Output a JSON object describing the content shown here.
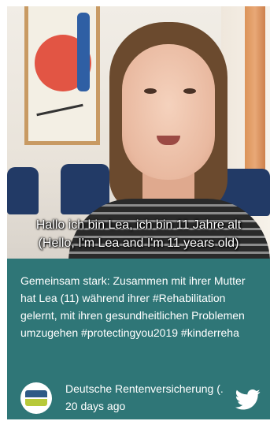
{
  "video": {
    "caption_line1": "Hallo ich bin Lea, ich bin 11 Jahre alt",
    "caption_line2": "(Hello, I'm Lea and I'm 11 years old)"
  },
  "post": {
    "text": "Gemeinsam stark: Zusammen mit ihrer Mutter hat Lea (11) während ihrer #Rehabilitation gelernt, mit ihren gesundheitlichen Problemen umzugehen #protectingyou2019 #kinderreha"
  },
  "author": {
    "name": "Deutsche Rentenversicherung (.",
    "time": "20 days ago",
    "avatar_icon": "drv-logo",
    "network_icon": "twitter-bird-icon"
  },
  "colors": {
    "card_bg": "#2f7677",
    "text": "#ffffff"
  }
}
